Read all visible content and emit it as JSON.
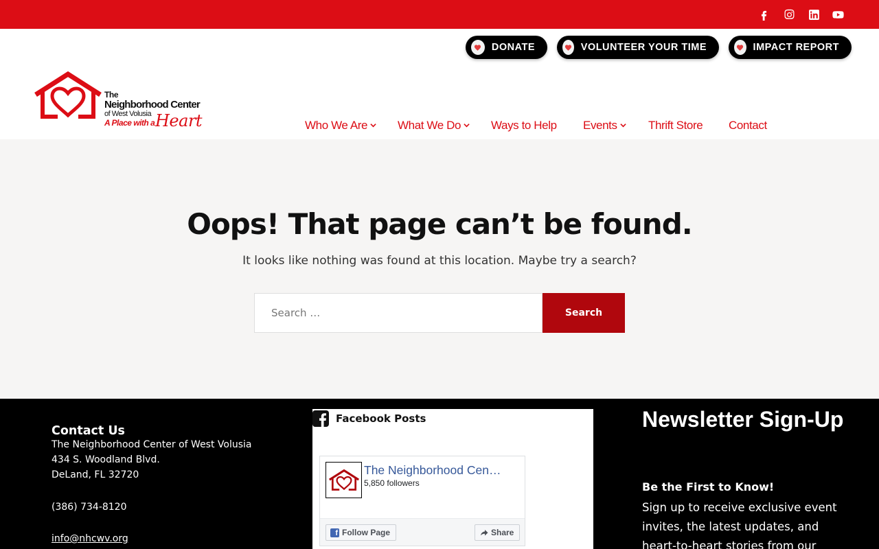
{
  "topbar": {
    "social": [
      "facebook-icon",
      "instagram-icon",
      "linkedin-icon",
      "youtube-icon"
    ],
    "color": "#dc0d15"
  },
  "action_buttons": [
    {
      "label": "DONATE",
      "icon": "heart-icon"
    },
    {
      "label": "VOLUNTEER YOUR TIME",
      "icon": "heart-icon"
    },
    {
      "label": "IMPACT REPORT",
      "icon": "heart-icon"
    }
  ],
  "logo": {
    "line1": "The",
    "line2": "Neighborhood Center",
    "line3": "of West Volusia",
    "line4": "A Place with a",
    "line5": "Heart"
  },
  "nav": [
    {
      "label": "Who We Are",
      "dropdown": true
    },
    {
      "label": "What We Do",
      "dropdown": true
    },
    {
      "label": "Ways to Help",
      "dropdown": false
    },
    {
      "label": "Events",
      "dropdown": true
    },
    {
      "label": "Thrift Store",
      "dropdown": false
    },
    {
      "label": "Contact",
      "dropdown": false
    }
  ],
  "main": {
    "heading": "Oops! That page can’t be found.",
    "subtext": "It looks like nothing was found at this location. Maybe try a search?",
    "search_placeholder": "Search …",
    "search_button": "Search"
  },
  "footer": {
    "contact": {
      "title": "Contact Us",
      "org": "The Neighborhood Center of West Volusia",
      "address1": "434 S. Woodland Blvd.",
      "address2": "DeLand, FL 32720",
      "phone": "(386) 734-8120",
      "email": "info@nhcwv.org"
    },
    "facebook": {
      "title": "Facebook Posts",
      "page_name": "The Neighborhood Center of West Volusia",
      "followers": "5,850 followers",
      "follow_label": "Follow Page",
      "share_label": "Share"
    },
    "newsletter": {
      "title": "Newsletter Sign-Up",
      "subtitle": "Be the First to Know!",
      "body": "Sign up to receive exclusive event invites, the latest updates, and heart-to-heart stories from our"
    }
  },
  "colors": {
    "brand_red": "#dc0d15",
    "button_red": "#b0070d",
    "main_bg": "#f6f5f4",
    "footer_bg": "#000000",
    "fb_blue": "#365899"
  }
}
